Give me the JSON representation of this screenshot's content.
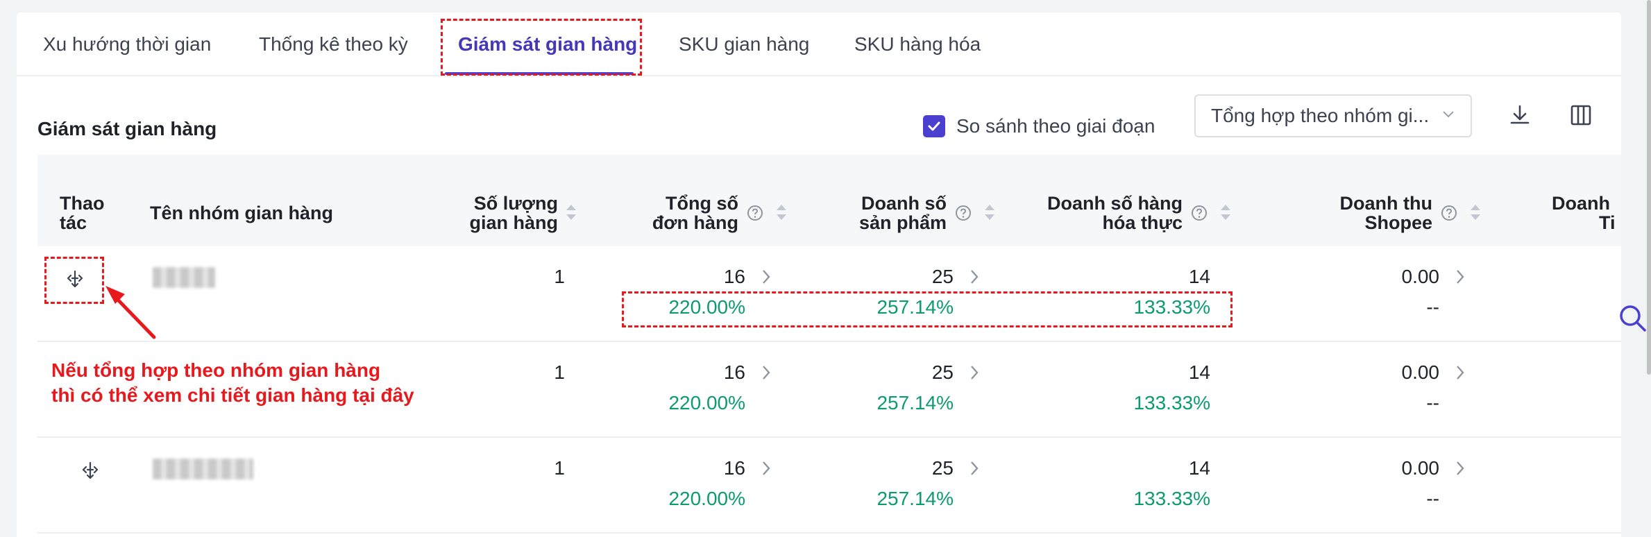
{
  "tabs": [
    {
      "label": "Xu hướng thời gian",
      "active": false
    },
    {
      "label": "Thống kê theo kỳ",
      "active": false
    },
    {
      "label": "Giám sát gian hàng",
      "active": true
    },
    {
      "label": "SKU gian hàng",
      "active": false
    },
    {
      "label": "SKU hàng hóa",
      "active": false
    }
  ],
  "toolbar": {
    "title": "Giám sát gian hàng",
    "compare_label": "So sánh theo giai đoạn",
    "compare_checked": true,
    "group_select_value": "Tổng hợp theo nhóm gi...",
    "download_icon": "download-icon",
    "columns_icon": "columns-icon"
  },
  "table": {
    "headers": {
      "action": [
        "Thao",
        "tác"
      ],
      "group_name": "Tên nhóm gian hàng",
      "shop_count": [
        "Số lượng",
        "gian hàng"
      ],
      "total_orders": [
        "Tổng số",
        "đơn hàng"
      ],
      "product_sales": [
        "Doanh số",
        "sản phẩm"
      ],
      "real_goods_sales": [
        "Doanh số hàng",
        "hóa thực"
      ],
      "shopee_revenue": [
        "Doanh thu",
        "Shopee"
      ],
      "next_col": [
        "Doanh",
        "Ti"
      ]
    },
    "rows": [
      {
        "shop_count": "1",
        "total_orders": "16",
        "total_orders_change": "220.00%",
        "product_sales": "25",
        "product_sales_change": "257.14%",
        "real_goods_sales": "14",
        "real_goods_sales_change": "133.33%",
        "shopee_revenue": "0.00",
        "shopee_revenue_change": "--"
      },
      {
        "shop_count": "1",
        "total_orders": "16",
        "total_orders_change": "220.00%",
        "product_sales": "25",
        "product_sales_change": "257.14%",
        "real_goods_sales": "14",
        "real_goods_sales_change": "133.33%",
        "shopee_revenue": "0.00",
        "shopee_revenue_change": "--"
      },
      {
        "shop_count": "1",
        "total_orders": "16",
        "total_orders_change": "220.00%",
        "product_sales": "25",
        "product_sales_change": "257.14%",
        "real_goods_sales": "14",
        "real_goods_sales_change": "133.33%",
        "shopee_revenue": "0.00",
        "shopee_revenue_change": "--"
      }
    ]
  },
  "annotation": {
    "line1": "Nếu tổng hợp theo nhóm gian hàng",
    "line2": "thì có thể xem chi tiết gian hàng tại đây"
  },
  "colors": {
    "accent": "#4b3fd0",
    "positive": "#0c9a72",
    "annotation": "#e8191e"
  }
}
